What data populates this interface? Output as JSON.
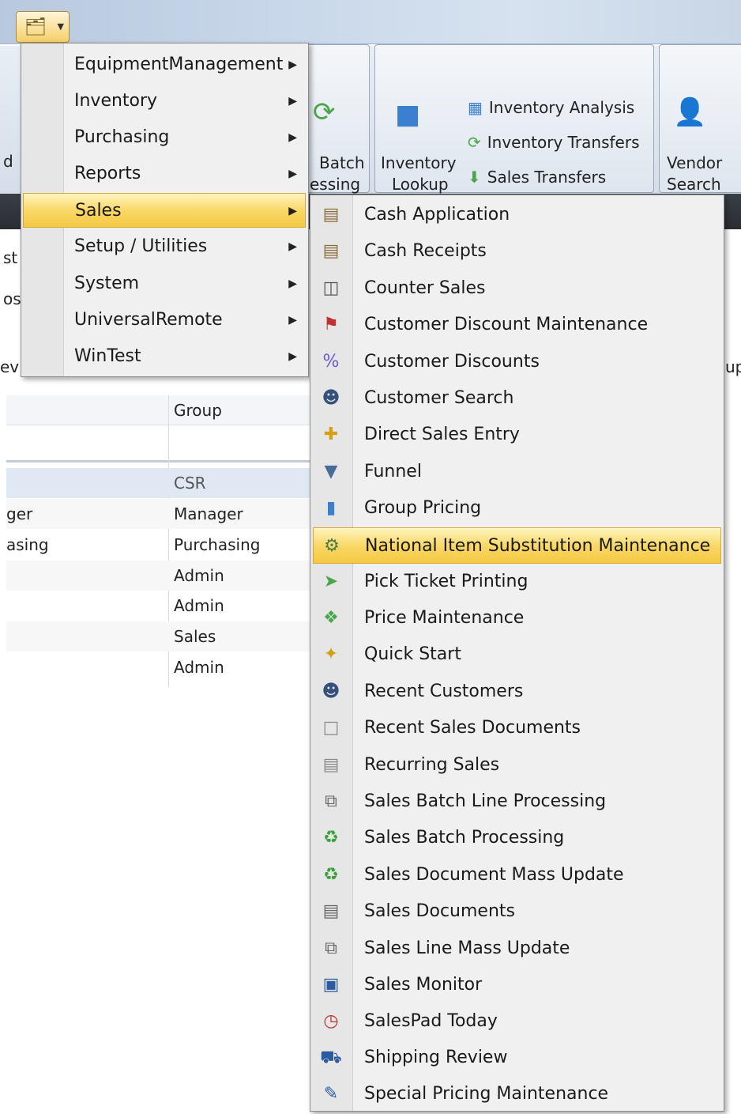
{
  "ribbon": {
    "batch_line1": "Batch",
    "batch_line2": "essing",
    "inventory_lookup_line1": "Inventory",
    "inventory_lookup_line2": "Lookup",
    "inventory_analysis": "Inventory Analysis",
    "inventory_transfers": "Inventory Transfers",
    "sales_transfers": "Sales Transfers",
    "vendor_search_line1": "Vendor",
    "vendor_search_line2": "Search",
    "left_frag_d": "d",
    "left_frag_st": "st",
    "left_frag_os": "os",
    "left_frag_ev": "ev",
    "right_frag_up": "up"
  },
  "grid": {
    "header_group": "Group",
    "rows": [
      {
        "left": "",
        "group": "CSR"
      },
      {
        "left": "ger",
        "group": "Manager"
      },
      {
        "left": "asing",
        "group": "Purchasing"
      },
      {
        "left": "",
        "group": "Admin"
      },
      {
        "left": "",
        "group": "Admin"
      },
      {
        "left": "",
        "group": "Sales"
      },
      {
        "left": "",
        "group": "Admin"
      }
    ]
  },
  "menu": {
    "items": [
      {
        "label": "EquipmentManagement"
      },
      {
        "label": "Inventory"
      },
      {
        "label": "Purchasing"
      },
      {
        "label": "Reports"
      },
      {
        "label": "Sales"
      },
      {
        "label": "Setup / Utilities"
      },
      {
        "label": "System"
      },
      {
        "label": "UniversalRemote"
      },
      {
        "label": "WinTest"
      }
    ],
    "active_index": 4
  },
  "submenu": {
    "items": [
      {
        "label": "Cash Application",
        "icon": "cash-application-icon"
      },
      {
        "label": "Cash Receipts",
        "icon": "cash-receipts-icon"
      },
      {
        "label": "Counter Sales",
        "icon": "register-icon"
      },
      {
        "label": "Customer Discount Maintenance",
        "icon": "discount-tag-icon"
      },
      {
        "label": "Customer Discounts",
        "icon": "percent-icon"
      },
      {
        "label": "Customer Search",
        "icon": "person-search-icon"
      },
      {
        "label": "Direct Sales Entry",
        "icon": "add-entry-icon"
      },
      {
        "label": "Funnel",
        "icon": "funnel-icon"
      },
      {
        "label": "Group Pricing",
        "icon": "group-pricing-icon"
      },
      {
        "label": "National Item Substitution Maintenance",
        "icon": "gear-substitution-icon"
      },
      {
        "label": "Pick Ticket Printing",
        "icon": "pick-ticket-icon"
      },
      {
        "label": "Price Maintenance",
        "icon": "price-tag-icon"
      },
      {
        "label": "Quick Start",
        "icon": "quick-start-icon"
      },
      {
        "label": "Recent Customers",
        "icon": "person-icon"
      },
      {
        "label": "Recent Sales Documents",
        "icon": "document-icon"
      },
      {
        "label": "Recurring Sales",
        "icon": "recurring-document-icon"
      },
      {
        "label": "Sales Batch Line Processing",
        "icon": "copy-documents-icon"
      },
      {
        "label": "Sales Batch Processing",
        "icon": "recycle-icon"
      },
      {
        "label": "Sales Document Mass Update",
        "icon": "recycle-update-icon"
      },
      {
        "label": "Sales Documents",
        "icon": "sales-documents-icon"
      },
      {
        "label": "Sales Line Mass Update",
        "icon": "copy-documents-icon"
      },
      {
        "label": "Sales Monitor",
        "icon": "monitor-icon"
      },
      {
        "label": "SalesPad Today",
        "icon": "calendar-icon"
      },
      {
        "label": "Shipping Review",
        "icon": "truck-icon"
      },
      {
        "label": "Special Pricing Maintenance",
        "icon": "pencil-icon"
      }
    ],
    "active_index": 9
  }
}
